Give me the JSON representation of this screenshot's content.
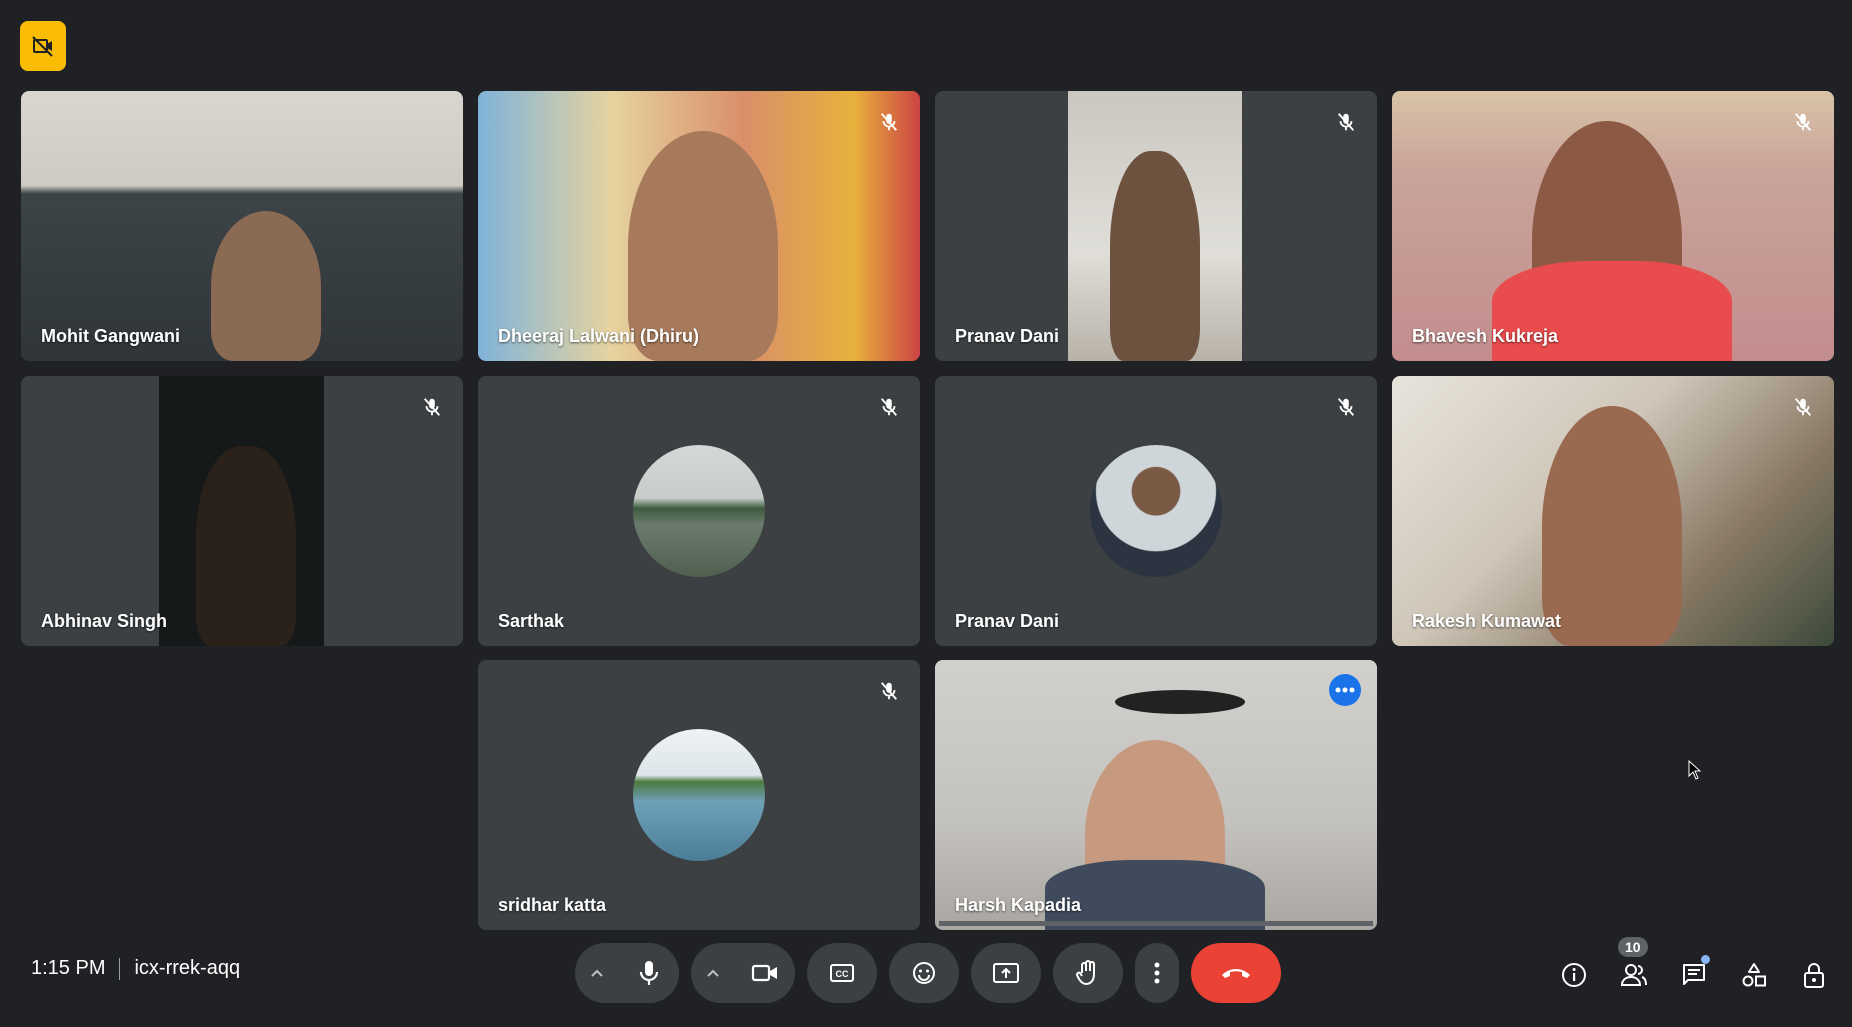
{
  "meeting": {
    "time": "1:15 PM",
    "code": "icx-rrek-aqq"
  },
  "tiles": [
    {
      "name": "Mohit Gangwani"
    },
    {
      "name": "Dheeraj Lalwani (Dhiru)"
    },
    {
      "name": "Pranav Dani"
    },
    {
      "name": "Bhavesh Kukreja"
    },
    {
      "name": "Abhinav Singh"
    },
    {
      "name": "Sarthak"
    },
    {
      "name": "Pranav Dani"
    },
    {
      "name": "Rakesh Kumawat"
    },
    {
      "name": "sridhar katta"
    },
    {
      "name": "Harsh Kapadia"
    }
  ],
  "people_count": "10",
  "colors": {
    "background": "#202124",
    "tile": "#3c4043",
    "end_call": "#ea4335",
    "accent": "#1a73e8"
  },
  "icons": [
    "camera-off-icon",
    "mic-off-icon",
    "more-dots-icon",
    "chevron-up-icon",
    "mic-icon",
    "camera-icon",
    "captions-icon",
    "emoji-icon",
    "present-icon",
    "raise-hand-icon",
    "more-vert-icon",
    "end-call-icon",
    "info-icon",
    "people-icon",
    "chat-icon",
    "activities-icon",
    "host-controls-icon"
  ]
}
